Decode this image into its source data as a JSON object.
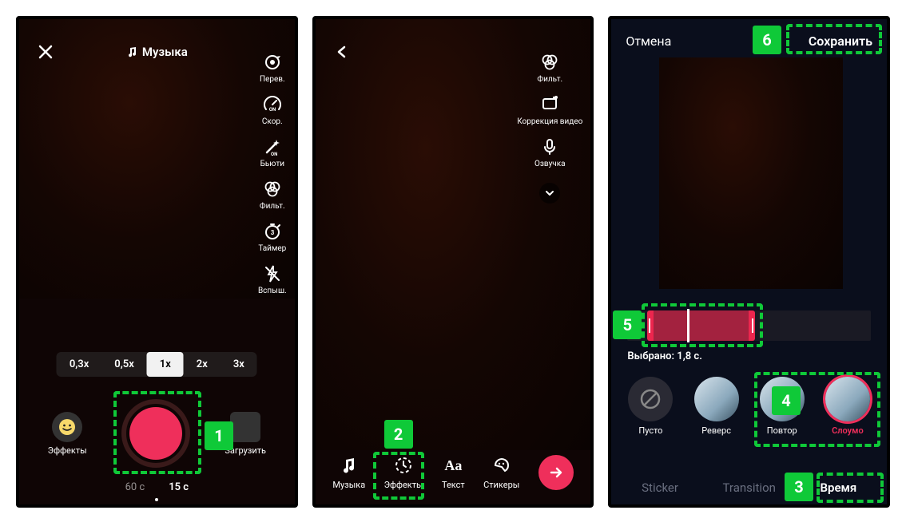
{
  "annotations": [
    "1",
    "2",
    "3",
    "4",
    "5",
    "6"
  ],
  "phone1": {
    "music_label": "Музыка",
    "tools": {
      "flip": "Перев.",
      "speed": "Скор.",
      "beauty": "Бьюти",
      "filters": "Фильт.",
      "timer": "Таймер",
      "flash": "Вспыш."
    },
    "speeds": [
      "0,3x",
      "0,5x",
      "1x",
      "2x",
      "3x"
    ],
    "speed_selected_index": 2,
    "effects_label": "Эффекты",
    "upload_label": "Загрузить",
    "durations": [
      "60 с",
      "15 с"
    ],
    "duration_selected_index": 1
  },
  "phone2": {
    "tools": {
      "filters": "Фильт.",
      "correction": "Коррекция видео",
      "voice": "Озвучка"
    },
    "bottom": {
      "music": "Музыка",
      "effects": "Эффекты",
      "text": "Текст",
      "stickers": "Стикеры"
    }
  },
  "phone3": {
    "cancel": "Отмена",
    "save": "Сохранить",
    "selected_label": "Выбрано: 1,8 с.",
    "fx": {
      "none": "Пусто",
      "reverse": "Реверс",
      "repeat": "Повтор",
      "slowmo": "Слоумо"
    },
    "categories": {
      "sticker": "Sticker",
      "transition": "Transition",
      "time": "Время"
    }
  }
}
